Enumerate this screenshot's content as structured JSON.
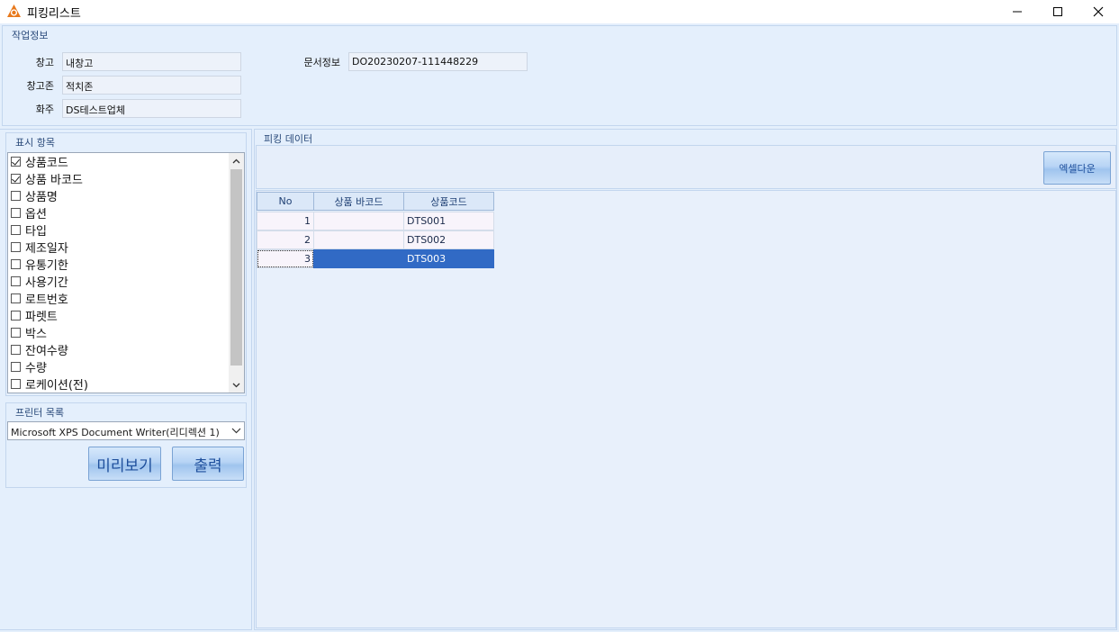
{
  "window": {
    "title": "피킹리스트",
    "app_icon": "cl-app-icon",
    "controls": [
      "minimize-icon",
      "maximize-icon",
      "close-icon"
    ]
  },
  "work_info": {
    "group_title": "작업정보",
    "warehouse_label": "창고",
    "warehouse_value": "내창고",
    "zone_label": "창고존",
    "zone_value": "적치존",
    "owner_label": "화주",
    "owner_value": "DS테스트업체",
    "doc_label": "문서정보",
    "doc_value": "DO20230207-111448229"
  },
  "display_items": {
    "group_title": "표시 항목",
    "items": [
      {
        "label": "상품코드",
        "checked": true
      },
      {
        "label": "상품 바코드",
        "checked": true
      },
      {
        "label": "상품명",
        "checked": false
      },
      {
        "label": "옵션",
        "checked": false
      },
      {
        "label": "타입",
        "checked": false
      },
      {
        "label": "제조일자",
        "checked": false
      },
      {
        "label": "유통기한",
        "checked": false
      },
      {
        "label": "사용기간",
        "checked": false
      },
      {
        "label": "로트번호",
        "checked": false
      },
      {
        "label": "파렛트",
        "checked": false
      },
      {
        "label": "박스",
        "checked": false
      },
      {
        "label": "잔여수량",
        "checked": false
      },
      {
        "label": "수량",
        "checked": false
      },
      {
        "label": "로케이션(전)",
        "checked": false
      }
    ]
  },
  "printer": {
    "group_title": "프린터 목록",
    "selected": "Microsoft XPS Document Writer(리디렉션 1)",
    "preview_label": "미리보기",
    "print_label": "출력"
  },
  "picking": {
    "group_title": "피킹 데이터",
    "excel_label": "엑셀다운",
    "columns": [
      "No",
      "상품 바코드",
      "상품코드"
    ],
    "rows": [
      {
        "no": "1",
        "barcode": "",
        "code": "DTS001",
        "selected": false
      },
      {
        "no": "2",
        "barcode": "",
        "code": "DTS002",
        "selected": false
      },
      {
        "no": "3",
        "barcode": "",
        "code": "DTS003",
        "selected": true
      }
    ]
  },
  "colors": {
    "background": "#e4effc",
    "selection": "#316ac5",
    "button_text": "#1e4f9c"
  }
}
